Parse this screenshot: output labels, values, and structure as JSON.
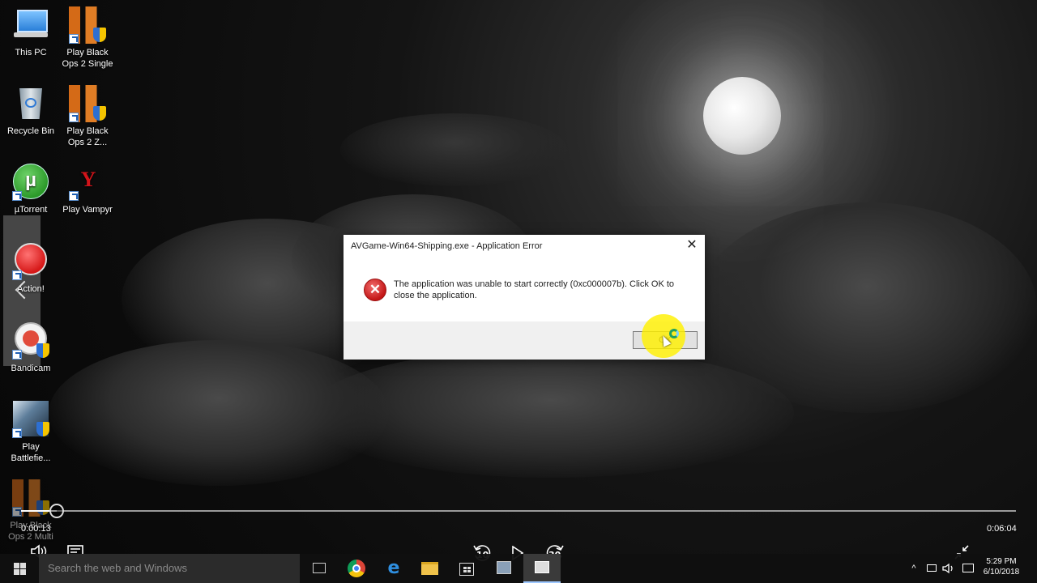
{
  "desktop": {
    "icons": [
      {
        "label": "This PC"
      },
      {
        "label": "Play Black Ops 2 Single"
      },
      {
        "label": "Recycle Bin"
      },
      {
        "label": "Play Black Ops 2 Z..."
      },
      {
        "label": "µTorrent"
      },
      {
        "label": "Play Vampyr"
      },
      {
        "label": "Action!"
      },
      {
        "label": "Bandicam"
      },
      {
        "label": "Play Battlefie..."
      },
      {
        "label": "Play Black Ops 2 Multi"
      }
    ]
  },
  "dialog": {
    "title": "AVGame-Win64-Shipping.exe - Application Error",
    "close_symbol": "✕",
    "icon": "error-icon",
    "message": "The application was unable to start correctly (0xc000007b). Click OK to close the application.",
    "ok_label": "OK"
  },
  "player": {
    "current_time": "0:00:13",
    "total_time": "0:06:04",
    "progress_fraction": 0.036,
    "skip_back_label": "10",
    "skip_forward_label": "30"
  },
  "taskbar": {
    "search_placeholder": "Search the web and Windows",
    "clock_time": "5:29 PM",
    "clock_date": "6/10/2018"
  }
}
